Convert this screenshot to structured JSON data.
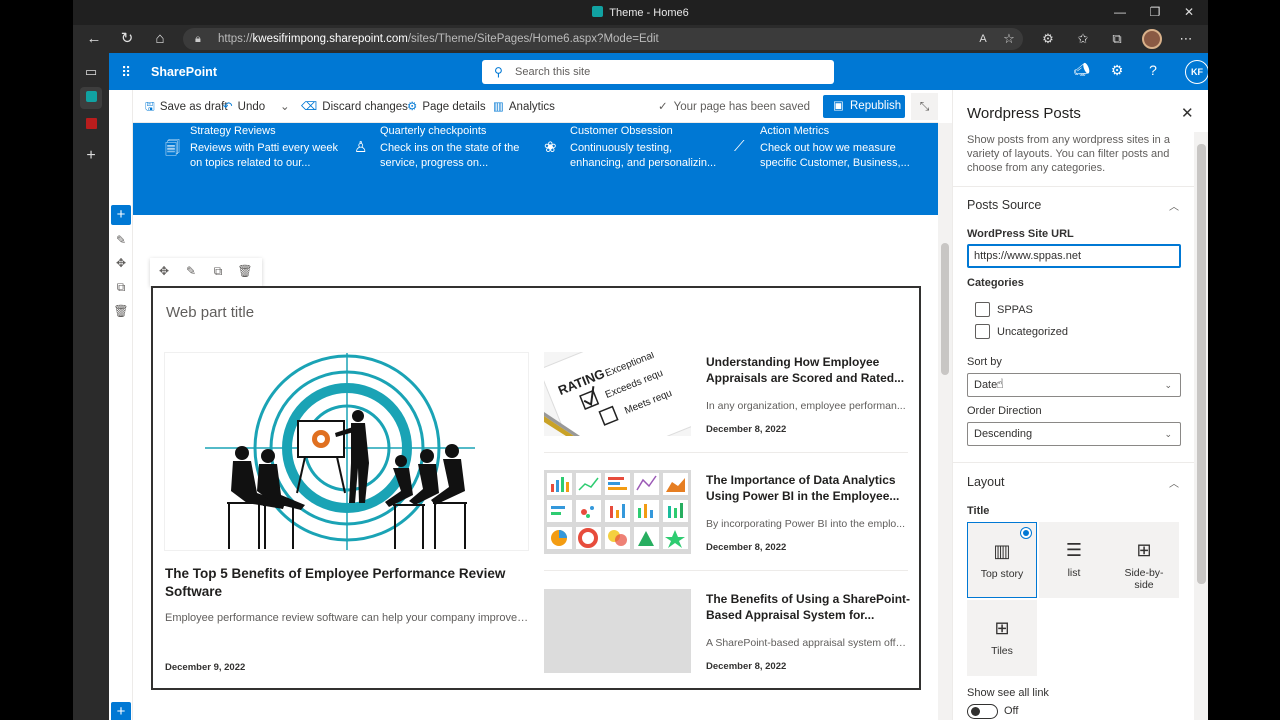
{
  "browser": {
    "window_title": "Theme - Home6",
    "url_prefix": "https://",
    "url_host": "kwesifrimpong.sharepoint.com",
    "url_path": "/sites/Theme/SitePages/Home6.aspx?Mode=Edit"
  },
  "suite": {
    "brand": "SharePoint",
    "search_placeholder": "Search this site",
    "user_initials": "KF"
  },
  "commands": {
    "save_draft": "Save as draft",
    "undo": "Undo",
    "discard": "Discard changes",
    "page_details": "Page details",
    "analytics": "Analytics",
    "saved_status": "Your page has been saved",
    "republish": "Republish"
  },
  "quick_links": [
    {
      "title": "Strategy Reviews",
      "line1": "Reviews with Patti every week",
      "line2": "on topics related to our..."
    },
    {
      "title": "Quarterly checkpoints",
      "line1": "Check ins on the state of the",
      "line2": "service, progress on..."
    },
    {
      "title": "Customer Obsession",
      "line1": "Continuously testing,",
      "line2": "enhancing, and personalizin..."
    },
    {
      "title": "Action Metrics",
      "line1": "Check out how we measure",
      "line2": "specific Customer, Business,..."
    }
  ],
  "webpart": {
    "title": "Web part title",
    "main_post": {
      "title": "The Top 5 Benefits of Employee Performance Review Software",
      "excerpt": "Employee performance review software can help your company improve pro...",
      "date": "December 9, 2022"
    },
    "posts": [
      {
        "title": "Understanding How Employee Appraisals are Scored and Rated...",
        "excerpt": "In any organization, employee performan...",
        "date": "December 8, 2022"
      },
      {
        "title": "The Importance of Data Analytics Using Power BI in the Employee...",
        "excerpt": "By incorporating Power BI into the emplo...",
        "date": "December 8, 2022"
      },
      {
        "title": "The Benefits of Using a SharePoint-Based Appraisal System for...",
        "excerpt": "A SharePoint-based appraisal system offe...",
        "date": "December 8, 2022"
      }
    ],
    "rating_words": [
      "RATING",
      "Exceptional",
      "Exceeds requ",
      "Meets requ"
    ]
  },
  "pane": {
    "title": "Wordpress Posts",
    "description": "Show posts from any wordpress sites in a variety of layouts. You can filter posts and choose from any categories.",
    "posts_source_section": "Posts Source",
    "site_url_label": "WordPress Site URL",
    "site_url_value": "https://www.sppas.net",
    "categories_label": "Categories",
    "categories": [
      "SPPAS",
      "Uncategorized"
    ],
    "sort_by_label": "Sort by",
    "sort_by_value": "Date",
    "order_label": "Order Direction",
    "order_value": "Descending",
    "layout_section": "Layout",
    "layout_title_label": "Title",
    "layouts": [
      "Top story",
      "list",
      "Side-by-side",
      "Tiles"
    ],
    "selected_layout": "Top story",
    "see_all_label": "Show see all link",
    "see_all_state": "Off"
  },
  "colors": {
    "brand": "#0078d4",
    "teal": "#1aa3b5"
  }
}
